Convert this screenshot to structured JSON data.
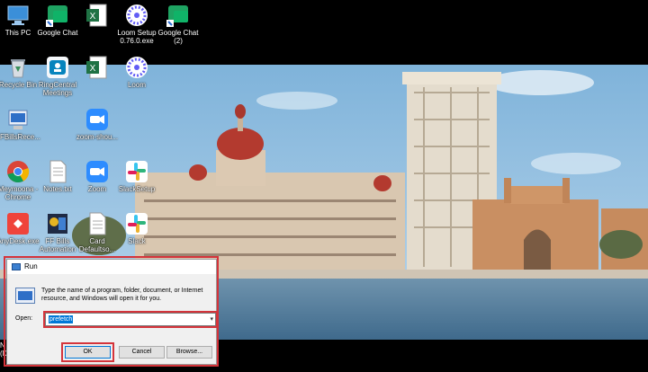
{
  "desktop_icons": [
    {
      "label": "This PC"
    },
    {
      "label": "Google Chat"
    },
    {
      "label": ""
    },
    {
      "label": "Loom Setup\n0.76.0.exe"
    },
    {
      "label": "Google Chat\n(2)"
    },
    {
      "label": "Recycle Bin"
    },
    {
      "label": "RingCentral\nMeetings"
    },
    {
      "label": ""
    },
    {
      "label": "Loom"
    },
    {
      "label": "FFBillsRece..."
    },
    {
      "label": "zoom-shou..."
    },
    {
      "label": "Meymoona -\nChrome"
    },
    {
      "label": "Notes.txt"
    },
    {
      "label": "Zoom"
    },
    {
      "label": "SlackSetup"
    },
    {
      "label": "AnyDesk.exe"
    },
    {
      "label": "FF Bills\nAutomation"
    },
    {
      "label": "Card\nDefaultso..."
    },
    {
      "label": "Slack"
    }
  ],
  "partial_label": "N\n(D",
  "run_dialog": {
    "title": "Run",
    "description": "Type the name of a program, folder, document, or Internet resource, and Windows will open it for you.",
    "open_label": "Open:",
    "open_value": "prefetch",
    "ok_label": "OK",
    "cancel_label": "Cancel",
    "browse_label": "Browse..."
  },
  "colors": {
    "highlight_outline": "#d4343b",
    "selection": "#0078d7"
  }
}
